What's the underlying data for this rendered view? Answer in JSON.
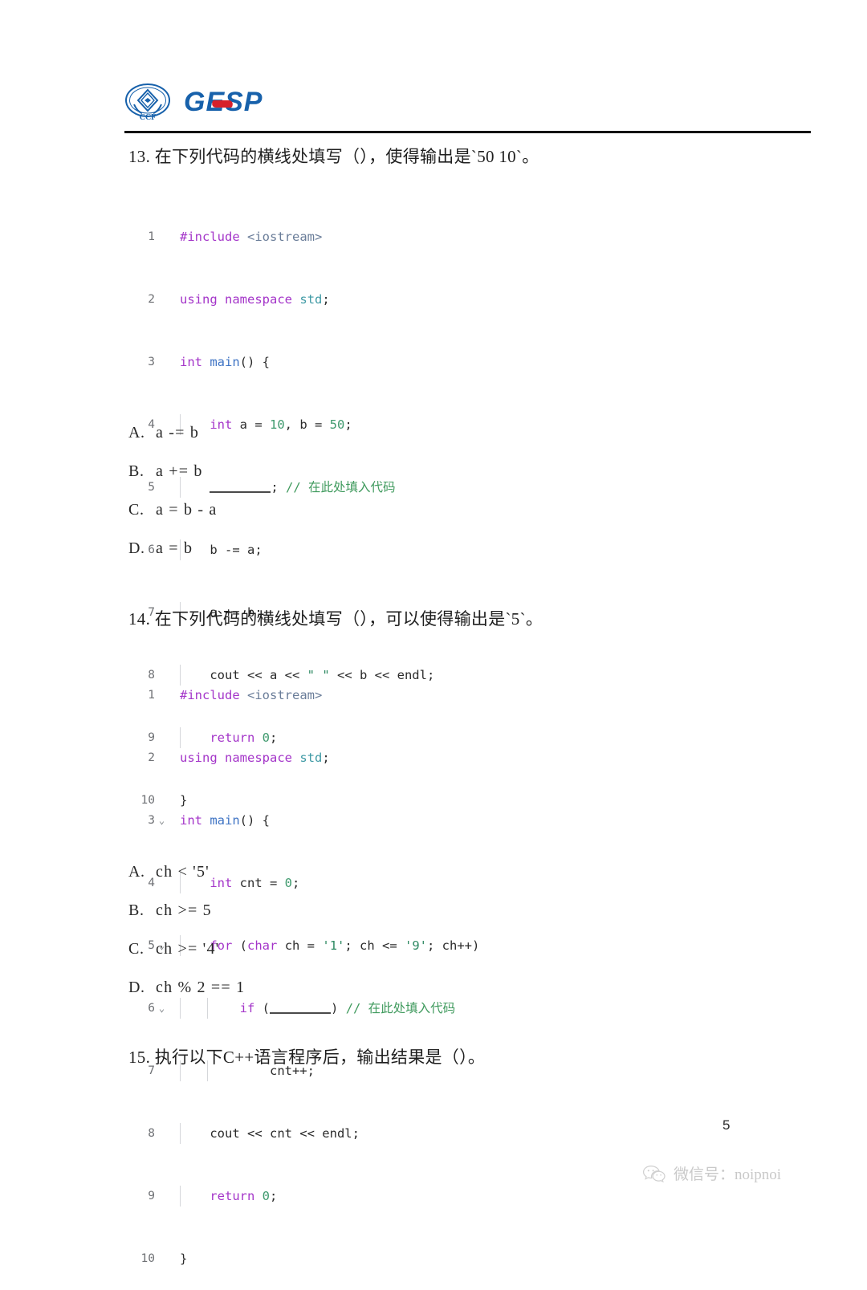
{
  "header": {
    "logo_emblem_name": "ccf-emblem",
    "logo_text": "GESP",
    "emblem_caption": "CCF"
  },
  "questions": [
    {
      "id": "q13",
      "text": "13. 在下列代码的横线处填写（），使得输出是`50 10`。"
    },
    {
      "id": "q14",
      "text": "14. 在下列代码的横线处填写（），可以使得输出是`5`。"
    },
    {
      "id": "q15",
      "text": "15. 执行以下C++语言程序后，输出结果是（）。"
    }
  ],
  "code_block_1": {
    "language": "cpp",
    "lines": [
      {
        "no": "1",
        "code": "#include <iostream>"
      },
      {
        "no": "2",
        "code": "using namespace std;"
      },
      {
        "no": "3",
        "code": "int main() {"
      },
      {
        "no": "4",
        "code": "    int a = 10, b = 50;"
      },
      {
        "no": "5",
        "code": "    ________; // 在此处填入代码"
      },
      {
        "no": "6",
        "code": "    b -= a;"
      },
      {
        "no": "7",
        "code": "    a += b;"
      },
      {
        "no": "8",
        "code": "    cout << a << \" \" << b << endl;"
      },
      {
        "no": "9",
        "code": "    return 0;"
      },
      {
        "no": "10",
        "code": "}"
      }
    ]
  },
  "code_block_2": {
    "language": "cpp",
    "lines": [
      {
        "no": "1",
        "fold": "",
        "code": "#include <iostream>"
      },
      {
        "no": "2",
        "fold": "",
        "code": "using namespace std;"
      },
      {
        "no": "3",
        "fold": "⌄",
        "code": "int main() {"
      },
      {
        "no": "4",
        "fold": "",
        "code": "    int cnt = 0;"
      },
      {
        "no": "5",
        "fold": "⌄",
        "code": "    for (char ch = '1'; ch <= '9'; ch++)"
      },
      {
        "no": "6",
        "fold": "⌄",
        "code": "        if (________) // 在此处填入代码"
      },
      {
        "no": "7",
        "fold": "",
        "code": "            cnt++;"
      },
      {
        "no": "8",
        "fold": "",
        "code": "    cout << cnt << endl;"
      },
      {
        "no": "9",
        "fold": "",
        "code": "    return 0;"
      },
      {
        "no": "10",
        "fold": "",
        "code": "}"
      }
    ]
  },
  "options_q13": [
    {
      "letter": "A.",
      "text": "a -= b"
    },
    {
      "letter": "B.",
      "text": "a += b"
    },
    {
      "letter": "C.",
      "text": "a = b - a"
    },
    {
      "letter": "D.",
      "text": "a = b"
    }
  ],
  "options_q14": [
    {
      "letter": "A.",
      "text": "ch < '5'"
    },
    {
      "letter": "B.",
      "text": "ch >= 5"
    },
    {
      "letter": "C.",
      "text": "ch >= '4'"
    },
    {
      "letter": "D.",
      "text": "ch % 2 == 1"
    }
  ],
  "footer": {
    "page_number": "5",
    "wechat_icon_name": "wechat-icon",
    "wechat_text": "微信号：noipnoi"
  },
  "colors": {
    "keyword": "#a435c9",
    "function": "#3f74c4",
    "include_path": "#6a7d99",
    "namespace": "#3f9aa5",
    "number": "#3f9a6e",
    "string": "#2f8a63",
    "comment": "#3f9a5d",
    "logo_blue": "#1761ab",
    "logo_red": "#d6202a",
    "footer_gray": "#c9c9c9"
  }
}
